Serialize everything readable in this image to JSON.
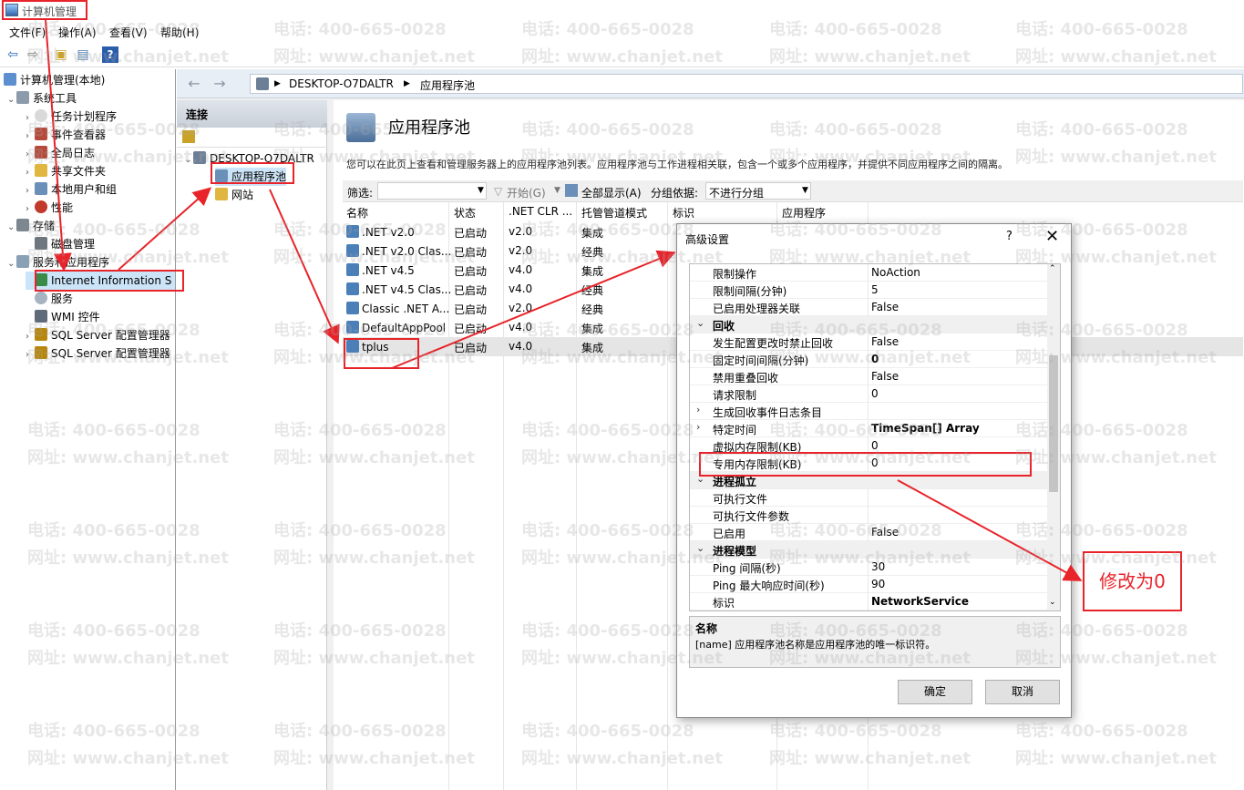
{
  "window": {
    "title": "计算机管理"
  },
  "menu": [
    "文件(F)",
    "操作(A)",
    "查看(V)",
    "帮助(H)"
  ],
  "left_tree": [
    {
      "label": "计算机管理(本地)",
      "indent": 0,
      "arrow": ""
    },
    {
      "label": "系统工具",
      "indent": 1,
      "arrow": "⌄"
    },
    {
      "label": "任务计划程序",
      "indent": 2,
      "arrow": "›"
    },
    {
      "label": "事件查看器",
      "indent": 2,
      "arrow": "›"
    },
    {
      "label": "全局日志",
      "indent": 2,
      "arrow": "›"
    },
    {
      "label": "共享文件夹",
      "indent": 2,
      "arrow": "›"
    },
    {
      "label": "本地用户和组",
      "indent": 2,
      "arrow": "›"
    },
    {
      "label": "性能",
      "indent": 2,
      "arrow": "›"
    },
    {
      "label": "存储",
      "indent": 1,
      "arrow": "⌄"
    },
    {
      "label": "磁盘管理",
      "indent": 2,
      "arrow": ""
    },
    {
      "label": "服务和应用程序",
      "indent": 1,
      "arrow": "⌄"
    },
    {
      "label": "Internet Information S",
      "indent": 2,
      "arrow": ""
    },
    {
      "label": "服务",
      "indent": 2,
      "arrow": ""
    },
    {
      "label": "WMI 控件",
      "indent": 2,
      "arrow": ""
    },
    {
      "label": "SQL Server 配置管理器",
      "indent": 2,
      "arrow": "›"
    },
    {
      "label": "SQL Server 配置管理器",
      "indent": 2,
      "arrow": "›"
    }
  ],
  "address": {
    "server": "DESKTOP-O7DALTR",
    "page": "应用程序池"
  },
  "connections": {
    "header": "连接",
    "server": "DESKTOP-O7DALTR",
    "items": [
      "应用程序池",
      "网站"
    ]
  },
  "main": {
    "title": "应用程序池",
    "description": "您可以在此页上查看和管理服务器上的应用程序池列表。应用程序池与工作进程相关联，包含一个或多个应用程序，并提供不同应用程序之间的隔离。",
    "filter_label": "筛选:",
    "start_label": "开始(G)",
    "show_all_label": "全部显示(A)",
    "group_label": "分组依据:",
    "group_value": "不进行分组",
    "columns": [
      "名称",
      "状态",
      ".NET CLR ...",
      "托管管道模式",
      "标识",
      "应用程序"
    ],
    "rows": [
      {
        "name": ".NET v2.0",
        "status": "已启动",
        "clr": "v2.0",
        "mode": "集成"
      },
      {
        "name": ".NET v2.0 Clas...",
        "status": "已启动",
        "clr": "v2.0",
        "mode": "经典"
      },
      {
        "name": ".NET v4.5",
        "status": "已启动",
        "clr": "v4.0",
        "mode": "集成"
      },
      {
        "name": ".NET v4.5 Clas...",
        "status": "已启动",
        "clr": "v4.0",
        "mode": "经典"
      },
      {
        "name": "Classic .NET A...",
        "status": "已启动",
        "clr": "v2.0",
        "mode": "经典"
      },
      {
        "name": "DefaultAppPool",
        "status": "已启动",
        "clr": "v4.0",
        "mode": "集成"
      },
      {
        "name": "tplus",
        "status": "已启动",
        "clr": "v4.0",
        "mode": "集成"
      }
    ]
  },
  "dialog": {
    "title": "高级设置",
    "help": "?",
    "close": "✕",
    "properties": [
      {
        "key": "限制操作",
        "value": "NoAction",
        "type": "prop"
      },
      {
        "key": "限制间隔(分钟)",
        "value": "5",
        "type": "prop"
      },
      {
        "key": "已启用处理器关联",
        "value": "False",
        "type": "prop"
      },
      {
        "key": "回收",
        "value": "",
        "type": "cat"
      },
      {
        "key": "发生配置更改时禁止回收",
        "value": "False",
        "type": "prop"
      },
      {
        "key": "固定时间间隔(分钟)",
        "value": "0",
        "type": "prop",
        "bold": true
      },
      {
        "key": "禁用重叠回收",
        "value": "False",
        "type": "prop"
      },
      {
        "key": "请求限制",
        "value": "0",
        "type": "prop"
      },
      {
        "key": "生成回收事件日志条目",
        "value": "",
        "type": "sub"
      },
      {
        "key": "特定时间",
        "value": "TimeSpan[] Array",
        "type": "sub",
        "bold": true
      },
      {
        "key": "虚拟内存限制(KB)",
        "value": "0",
        "type": "prop"
      },
      {
        "key": "专用内存限制(KB)",
        "value": "0",
        "type": "prop"
      },
      {
        "key": "进程孤立",
        "value": "",
        "type": "cat"
      },
      {
        "key": "可执行文件",
        "value": "",
        "type": "prop"
      },
      {
        "key": "可执行文件参数",
        "value": "",
        "type": "prop"
      },
      {
        "key": "已启用",
        "value": "False",
        "type": "prop"
      },
      {
        "key": "进程模型",
        "value": "",
        "type": "cat"
      },
      {
        "key": "Ping 间隔(秒)",
        "value": "30",
        "type": "prop"
      },
      {
        "key": "Ping 最大响应时间(秒)",
        "value": "90",
        "type": "prop"
      },
      {
        "key": "标识",
        "value": "NetworkService",
        "type": "prop",
        "bold": true
      }
    ],
    "desc_title": "名称",
    "desc_text": "[name] 应用程序池名称是应用程序池的唯一标识符。",
    "ok": "确定",
    "cancel": "取消"
  },
  "annotation": {
    "note": "修改为0",
    "color": "#e8232a"
  },
  "watermark": {
    "phone": "电话: 400-665-0028",
    "site": "网址: www.chanjet.net"
  }
}
